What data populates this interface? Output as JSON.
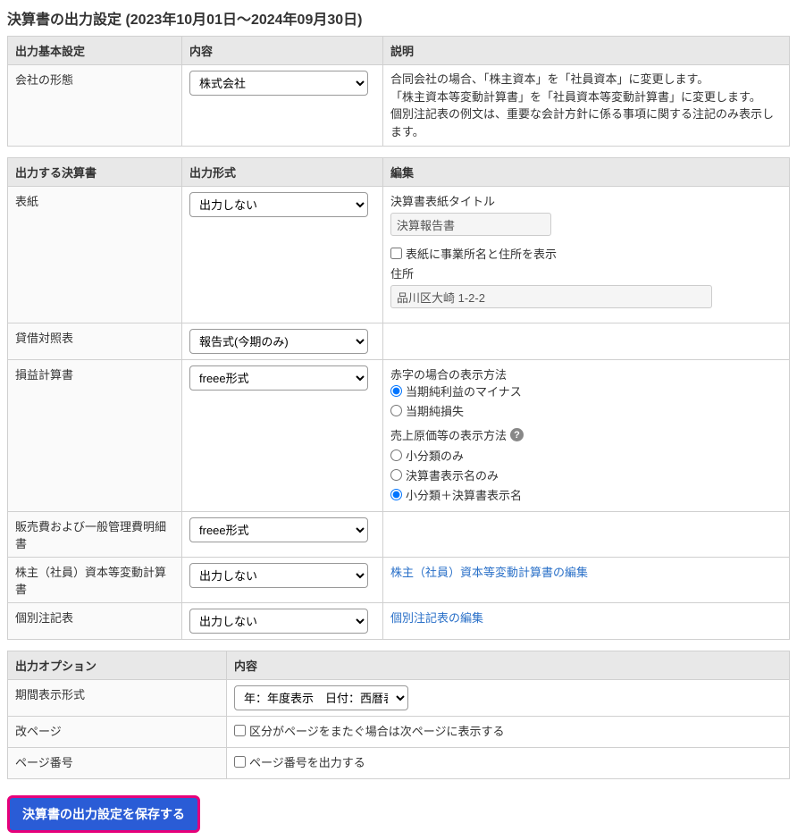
{
  "title": "決算書の出力設定 (2023年10月01日～2024年09月30日)",
  "t1": {
    "head": {
      "c0": "出力基本設定",
      "c1": "内容",
      "c2": "説明"
    },
    "row0": {
      "label": "会社の形態",
      "select": "株式会社",
      "desc1": "合同会社の場合、「株主資本」を「社員資本」に変更します。",
      "desc2": "「株主資本等変動計算書」を「社員資本等変動計算書」に変更します。",
      "desc3": "個別注記表の例文は、重要な会計方針に係る事項に関する注記のみ表示します。"
    }
  },
  "t2": {
    "head": {
      "c0": "出力する決算書",
      "c1": "出力形式",
      "c2": "編集"
    },
    "cover": {
      "label": "表紙",
      "select": "出力しない",
      "title_label": "決算書表紙タイトル",
      "title_value": "決算報告書",
      "chk_label": "表紙に事業所名と住所を表示",
      "addr_label": "住所",
      "addr_value": "品川区大崎 1-2-2"
    },
    "bs": {
      "label": "貸借対照表",
      "select": "報告式(今期のみ)"
    },
    "pl": {
      "label": "損益計算書",
      "select": "freee形式",
      "red_label": "赤字の場合の表示方法",
      "red_opt1": "当期純利益のマイナス",
      "red_opt2": "当期純損失",
      "cogs_label": "売上原価等の表示方法",
      "cogs_opt1": "小分類のみ",
      "cogs_opt2": "決算書表示名のみ",
      "cogs_opt3": "小分類＋決算書表示名"
    },
    "sga": {
      "label": "販売費および一般管理費明細書",
      "select": "freee形式"
    },
    "equity": {
      "label": "株主（社員）資本等変動計算書",
      "select": "出力しない",
      "link": "株主（社員）資本等変動計算書の編集"
    },
    "notes": {
      "label": "個別注記表",
      "select": "出力しない",
      "link": "個別注記表の編集"
    }
  },
  "t3": {
    "head": {
      "c0": "出力オプション",
      "c1": "内容"
    },
    "period": {
      "label": "期間表示形式",
      "select": "年：年度表示　日付：西暦表示"
    },
    "pagebreak": {
      "label": "改ページ",
      "chk": "区分がページをまたぐ場合は次ページに表示する"
    },
    "pagenum": {
      "label": "ページ番号",
      "chk": "ページ番号を出力する"
    }
  },
  "save_button": "決算書の出力設定を保存する"
}
